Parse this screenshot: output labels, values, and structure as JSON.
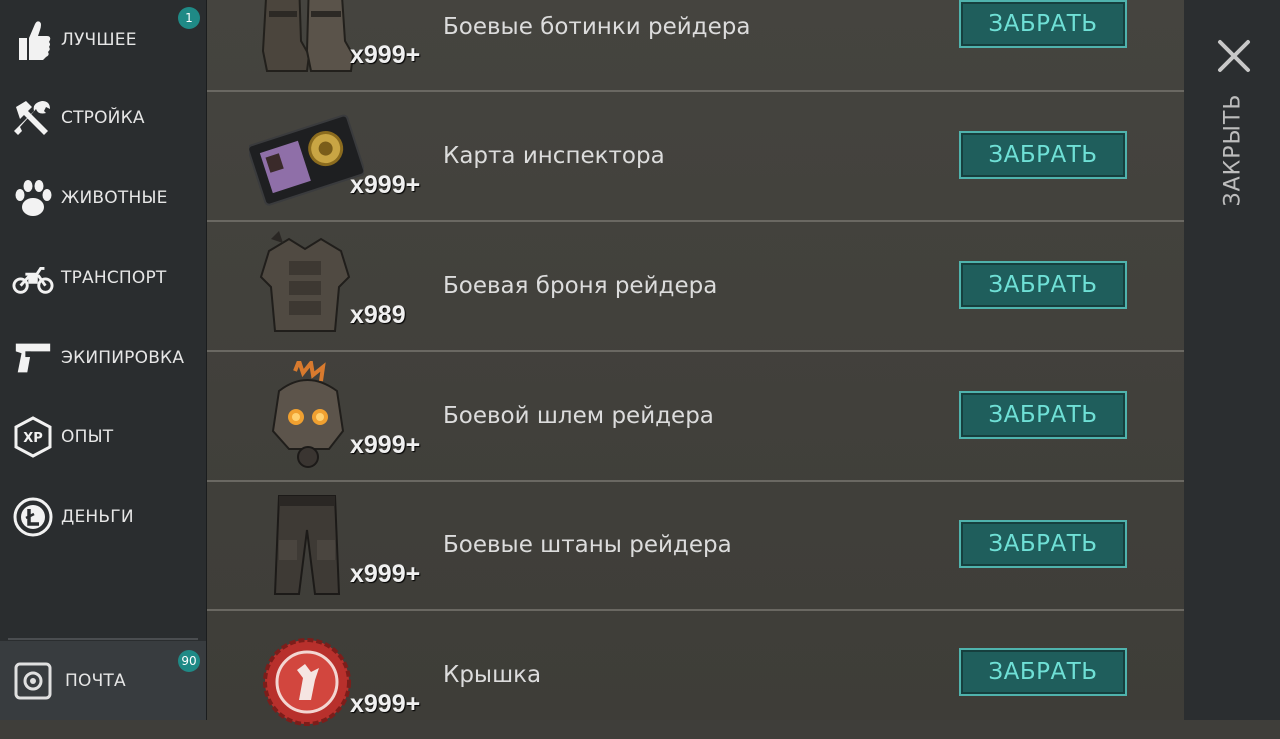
{
  "sidebar": {
    "items": [
      {
        "label": "ЛУЧШЕЕ",
        "icon": "thumbs-up-icon",
        "badge": "1"
      },
      {
        "label": "СТРОЙКА",
        "icon": "hammer-wrench-icon"
      },
      {
        "label": "ЖИВОТНЫЕ",
        "icon": "paw-icon"
      },
      {
        "label": "ТРАНСПОРТ",
        "icon": "motorcycle-icon"
      },
      {
        "label": "ЭКИПИРОВКА",
        "icon": "pistol-icon"
      },
      {
        "label": "ОПЫТ",
        "icon": "xp-icon",
        "icon_text": "XP"
      },
      {
        "label": "ДЕНЬГИ",
        "icon": "coin-icon"
      }
    ],
    "mail": {
      "label": "ПОЧТА",
      "icon": "safe-icon",
      "badge": "90"
    }
  },
  "rewards": [
    {
      "name": "Боевые ботинки рейдера",
      "quantity": "x999+",
      "icon": "boots-icon",
      "button": "ЗАБРАТЬ"
    },
    {
      "name": "Карта инспектора",
      "quantity": "x999+",
      "icon": "badge-wallet-icon",
      "button": "ЗАБРАТЬ"
    },
    {
      "name": "Боевая броня рейдера",
      "quantity": "x989",
      "icon": "armor-icon",
      "button": "ЗАБРАТЬ"
    },
    {
      "name": "Боевой шлем рейдера",
      "quantity": "x999+",
      "icon": "helmet-icon",
      "button": "ЗАБРАТЬ"
    },
    {
      "name": "Боевые штаны рейдера",
      "quantity": "x999+",
      "icon": "pants-icon",
      "button": "ЗАБРАТЬ"
    },
    {
      "name": "Крышка",
      "quantity": "x999+",
      "icon": "bottle-cap-icon",
      "button": "ЗАБРАТЬ"
    }
  ],
  "close": {
    "label": "ЗАКРЫТЬ",
    "icon": "close-icon"
  },
  "colors": {
    "accent": "#1f8a86",
    "button_text": "#6fe0d6",
    "sidebar_bg": "#2a2d2f"
  }
}
